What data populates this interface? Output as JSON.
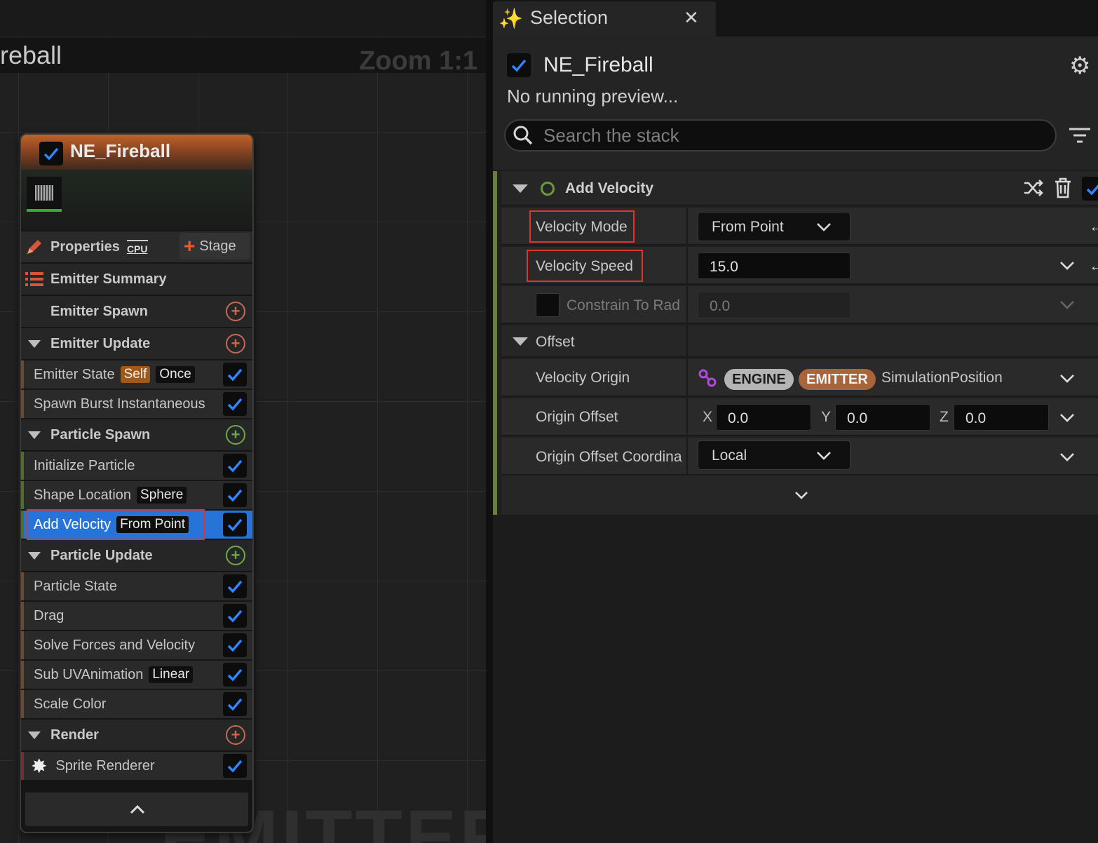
{
  "graph": {
    "title_fragment": "reball",
    "zoom": "Zoom 1:1",
    "watermark": "EMITTER",
    "node": {
      "title": "NE_Fireball",
      "properties_label": "Properties",
      "cpu_badge": "CPU",
      "stage_label": "Stage",
      "emitter_summary": "Emitter Summary",
      "rows": [
        {
          "kind": "section-plain",
          "label": "Emitter Spawn"
        },
        {
          "kind": "section",
          "label": "Emitter Update"
        },
        {
          "kind": "item",
          "label": "Emitter State",
          "tags": [
            "Self",
            "Once"
          ]
        },
        {
          "kind": "item",
          "label": "Spawn Burst Instantaneous",
          "tags": []
        },
        {
          "kind": "section",
          "label": "Particle Spawn"
        },
        {
          "kind": "item",
          "label": "Initialize Particle",
          "tags": []
        },
        {
          "kind": "item",
          "label": "Shape Location",
          "tags": [
            "Sphere"
          ]
        },
        {
          "kind": "item",
          "label": "Add Velocity",
          "tags": [
            "From Point"
          ],
          "selected": true
        },
        {
          "kind": "section",
          "label": "Particle Update"
        },
        {
          "kind": "item",
          "label": "Particle State",
          "tags": []
        },
        {
          "kind": "item",
          "label": "Drag",
          "tags": []
        },
        {
          "kind": "item",
          "label": "Solve Forces and Velocity",
          "tags": []
        },
        {
          "kind": "item",
          "label": "Sub UVAnimation",
          "tags": [
            "Linear"
          ]
        },
        {
          "kind": "item",
          "label": "Scale Color",
          "tags": []
        },
        {
          "kind": "section",
          "label": "Render"
        },
        {
          "kind": "item",
          "label": "Sprite Renderer",
          "tags": []
        }
      ]
    }
  },
  "details": {
    "tab_label": "Selection",
    "emitter_name": "NE_Fireball",
    "preview_status": "No running preview...",
    "search_placeholder": "Search the stack",
    "module": {
      "title": "Add Velocity",
      "velocity_mode_label": "Velocity Mode",
      "velocity_mode_value": "From Point",
      "velocity_speed_label": "Velocity Speed",
      "velocity_speed_value": "15.0",
      "constrain_label": "Constrain To Rad",
      "constrain_value": "0.0",
      "offset_label": "Offset",
      "velocity_origin_label": "Velocity Origin",
      "engine_pill": "ENGINE",
      "emitter_pill": "EMITTER",
      "velocity_origin_value": "SimulationPosition",
      "origin_offset_label": "Origin Offset",
      "x_label": "X",
      "x_value": "0.0",
      "y_label": "Y",
      "y_value": "0.0",
      "z_label": "Z",
      "z_value": "0.0",
      "coord_label": "Origin Offset Coordina",
      "coord_value": "Local"
    }
  },
  "colors": {
    "accent_blue": "#2673d9",
    "highlight_red": "#d8382b",
    "engine_pill": "#b5b5b5",
    "emitter_pill": "#a8643a"
  }
}
